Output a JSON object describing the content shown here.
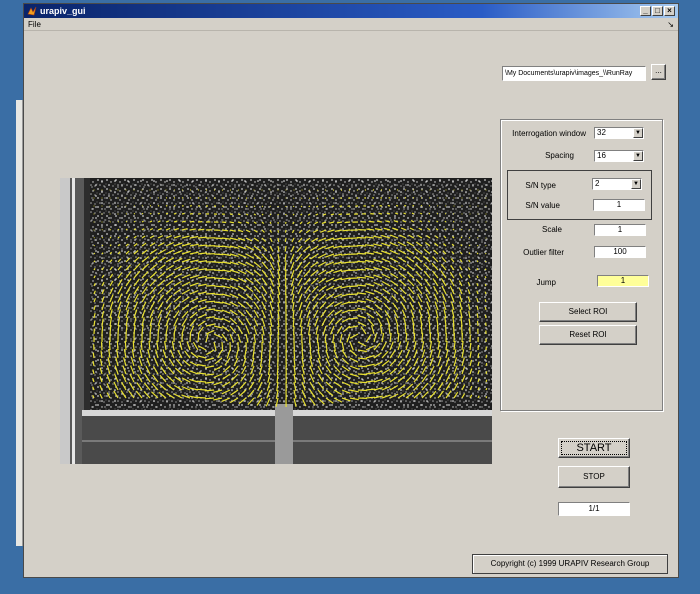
{
  "window": {
    "title": "urapiv_gui",
    "controls": {
      "minimize": "_",
      "maximize": "□",
      "close": "×"
    }
  },
  "menubar": {
    "file_label": "File",
    "dock_icon": "↘"
  },
  "path": {
    "value": "\\My Documents\\urapiv\\images_\\\\RunRay",
    "browse_label": "..."
  },
  "params": {
    "interrogation_window_label": "Interrogation window",
    "interrogation_window_value": "32",
    "spacing_label": "Spacing",
    "spacing_value": "16",
    "sn_type_label": "S/N type",
    "sn_type_value": "2",
    "sn_value_label": "S/N value",
    "sn_value_value": "1",
    "scale_label": "Scale",
    "scale_value": "1",
    "outlier_filter_label": "Outlier filter",
    "outlier_filter_value": "100",
    "jump_label": "Jump",
    "jump_value": "1"
  },
  "buttons": {
    "select_roi": "Select ROI",
    "reset_roi": "Reset ROI",
    "start": "START",
    "stop": "STOP"
  },
  "status": {
    "progress": "1/1"
  },
  "footer": {
    "copyright": "Copyright (c) 1999 URAPIV Research Group"
  },
  "colors": {
    "vector": "#e8e030",
    "field_highlight": "#ffff99",
    "title_bar": "#0a246a"
  }
}
